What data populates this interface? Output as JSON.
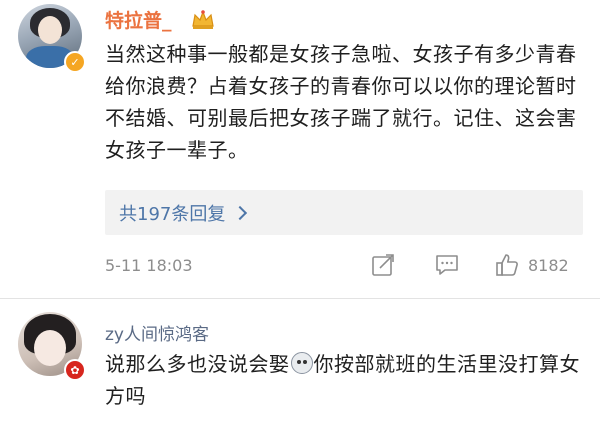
{
  "comments": [
    {
      "username": "特拉普_",
      "text": "当然这种事一般都是女孩子急啦、女孩子有多少青春给你浪费？占着女孩子的青春你可以以你的理论暂时不结婚、可别最后把女孩子踹了就行。记住、这会害女孩子一辈子。",
      "replies_label": "共197条回复",
      "timestamp": "5-11 18:03",
      "like_count": "8182"
    },
    {
      "username": "zy人间惊鸿客",
      "text_before_emoji": "说那么多也没说会娶",
      "text_after_emoji": "你按部就班的生活里没打算女方吗"
    }
  ],
  "icons": {
    "badge_1": "vip-badge-icon",
    "badge_2": "region-badge-icon",
    "crown": "crown-icon",
    "share": "share-icon",
    "reply": "comment-icon",
    "like": "thumbs-up-icon",
    "chevron": "chevron-right-icon"
  },
  "colors": {
    "username_highlight": "#eb7340",
    "username_normal": "#5a6a85",
    "link": "#4e76a8",
    "meta": "#8d8d8d"
  }
}
